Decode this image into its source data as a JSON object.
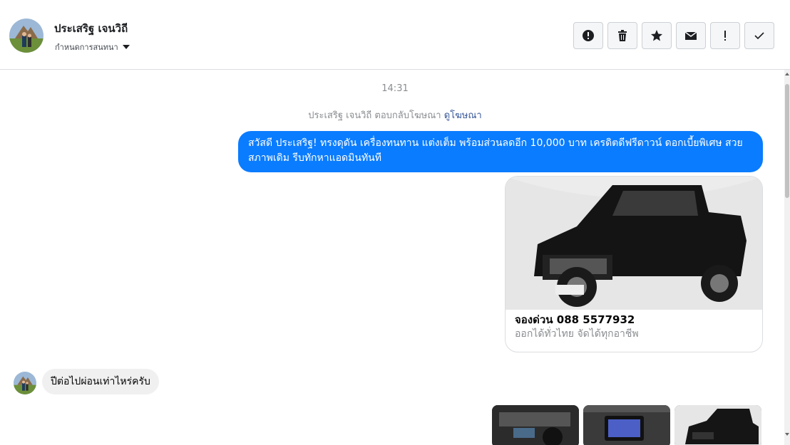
{
  "header": {
    "contact_name": "ประเสริฐ เจนวิถี",
    "assign_label": "กำหนดการสนทนา",
    "actions": [
      {
        "icon": "alert-circle-icon",
        "name": "spam-button"
      },
      {
        "icon": "trash-icon",
        "name": "delete-button"
      },
      {
        "icon": "star-icon",
        "name": "star-button"
      },
      {
        "icon": "envelope-icon",
        "name": "mark-unread-button"
      },
      {
        "icon": "exclamation-icon",
        "name": "follow-up-button"
      },
      {
        "icon": "check-icon",
        "name": "mark-done-button"
      }
    ]
  },
  "thread": {
    "timestamp": "14:31",
    "system_message": "ประเสริฐ เจนวิถี ตอบกลับโฆษณา",
    "system_link": "ดูโฆษณา",
    "outgoing_message": "สวัสดี ประเสริฐ!  ทรงดุดัน เครื่องทนทาน แต่งเต็ม พร้อมส่วนลดอีก 10,000 บาท เครดิตดีฟรีดาวน์ ดอกเบี้ยพิเศษ สวยสภาพเดิม รีบทักหาแอดมินทันที",
    "ad_card": {
      "title": "จองด่วน 088 5577932",
      "subtitle": "ออกได้ทั่วไทย จัดได้ทุกอาชีพ"
    },
    "incoming_message": "ปีต่อไปผ่อนเท่าไหร่ครับ"
  },
  "colors": {
    "outgoing_bubble": "#0a7cff",
    "incoming_bubble": "#f0f0f0",
    "link": "#385898"
  }
}
